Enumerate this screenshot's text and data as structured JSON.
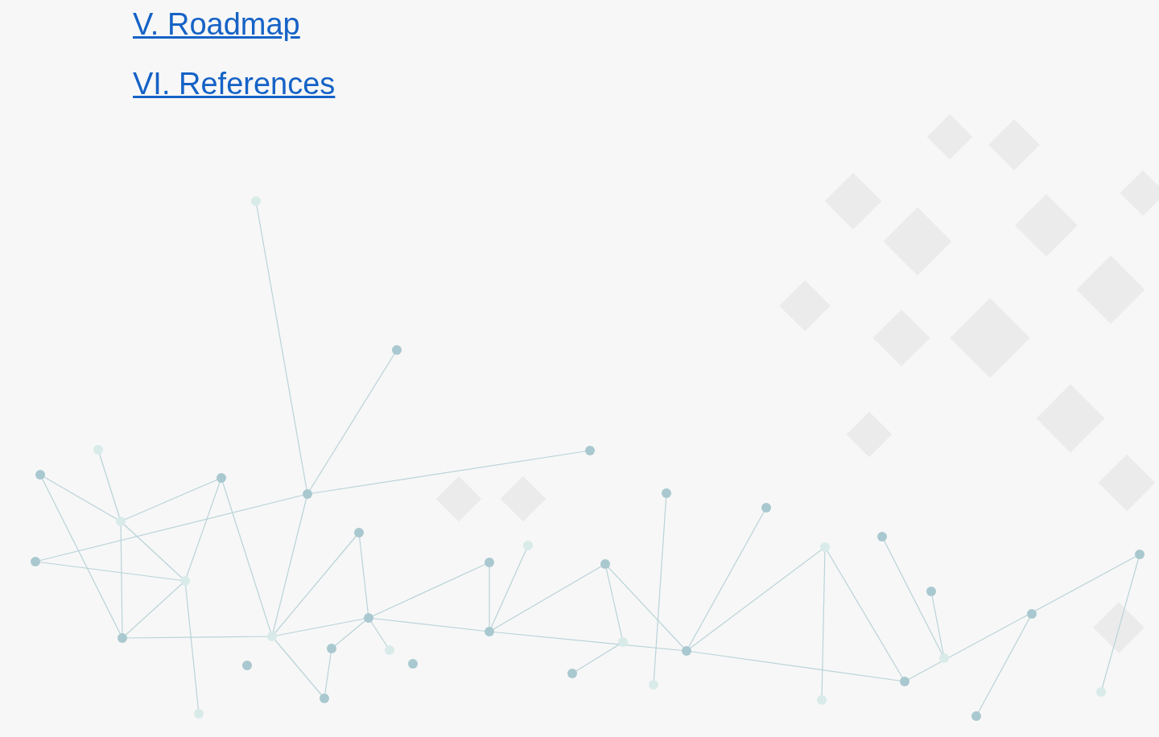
{
  "links": [
    {
      "label": "V. Roadmap"
    },
    {
      "label": "VI. References"
    }
  ]
}
